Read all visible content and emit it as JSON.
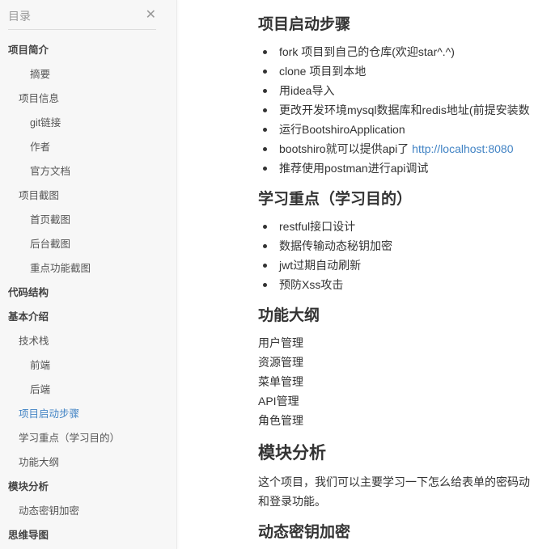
{
  "sidebar": {
    "title": "目录",
    "close_icon": "close-icon",
    "items": [
      {
        "label": "项目简介",
        "level": 1
      },
      {
        "label": "摘要",
        "level": 3
      },
      {
        "label": "项目信息",
        "level": 2
      },
      {
        "label": "git链接",
        "level": 3
      },
      {
        "label": "作者",
        "level": 3
      },
      {
        "label": "官方文档",
        "level": 3
      },
      {
        "label": "项目截图",
        "level": 2
      },
      {
        "label": "首页截图",
        "level": 3
      },
      {
        "label": "后台截图",
        "level": 3
      },
      {
        "label": "重点功能截图",
        "level": 3
      },
      {
        "label": "代码结构",
        "level": 1
      },
      {
        "label": "基本介绍",
        "level": 1
      },
      {
        "label": "技术栈",
        "level": 2
      },
      {
        "label": "前端",
        "level": 3
      },
      {
        "label": "后端",
        "level": 3
      },
      {
        "label": "项目启动步骤",
        "level": 2,
        "active": true
      },
      {
        "label": "学习重点（学习目的）",
        "level": 2
      },
      {
        "label": "功能大纲",
        "level": 2
      },
      {
        "label": "模块分析",
        "level": 1
      },
      {
        "label": "动态密钥加密",
        "level": 2
      },
      {
        "label": "思维导图",
        "level": 1
      }
    ]
  },
  "main": {
    "s1": {
      "title": "项目启动步骤",
      "items": [
        "fork 项目到自己的仓库(欢迎star^.^)",
        "clone 项目到本地",
        "用idea导入",
        "更改开发环境mysql数据库和redis地址(前提安装数",
        "运行BootshiroApplication",
        "bootshiro就可以提供api了 "
      ],
      "link": "http://localhost:8080",
      "last": "推荐使用postman进行api调试"
    },
    "s2": {
      "title": "学习重点（学习目的）",
      "items": [
        "restful接口设计",
        "数据传输动态秘钥加密",
        "jwt过期自动刷新",
        "预防Xss攻击"
      ]
    },
    "s3": {
      "title": "功能大纲",
      "lines": [
        "用户管理",
        "资源管理",
        "菜单管理",
        "API管理",
        "角色管理"
      ]
    },
    "s4": {
      "title": "模块分析",
      "para1": "这个项目，我们可以主要学习一下怎么给表单的密码动",
      "para2": "和登录功能。"
    },
    "s5": {
      "title": "动态密钥加密"
    },
    "colors": {
      "link": "#4183c4",
      "sidebar_bg": "#f7f7f7"
    }
  }
}
